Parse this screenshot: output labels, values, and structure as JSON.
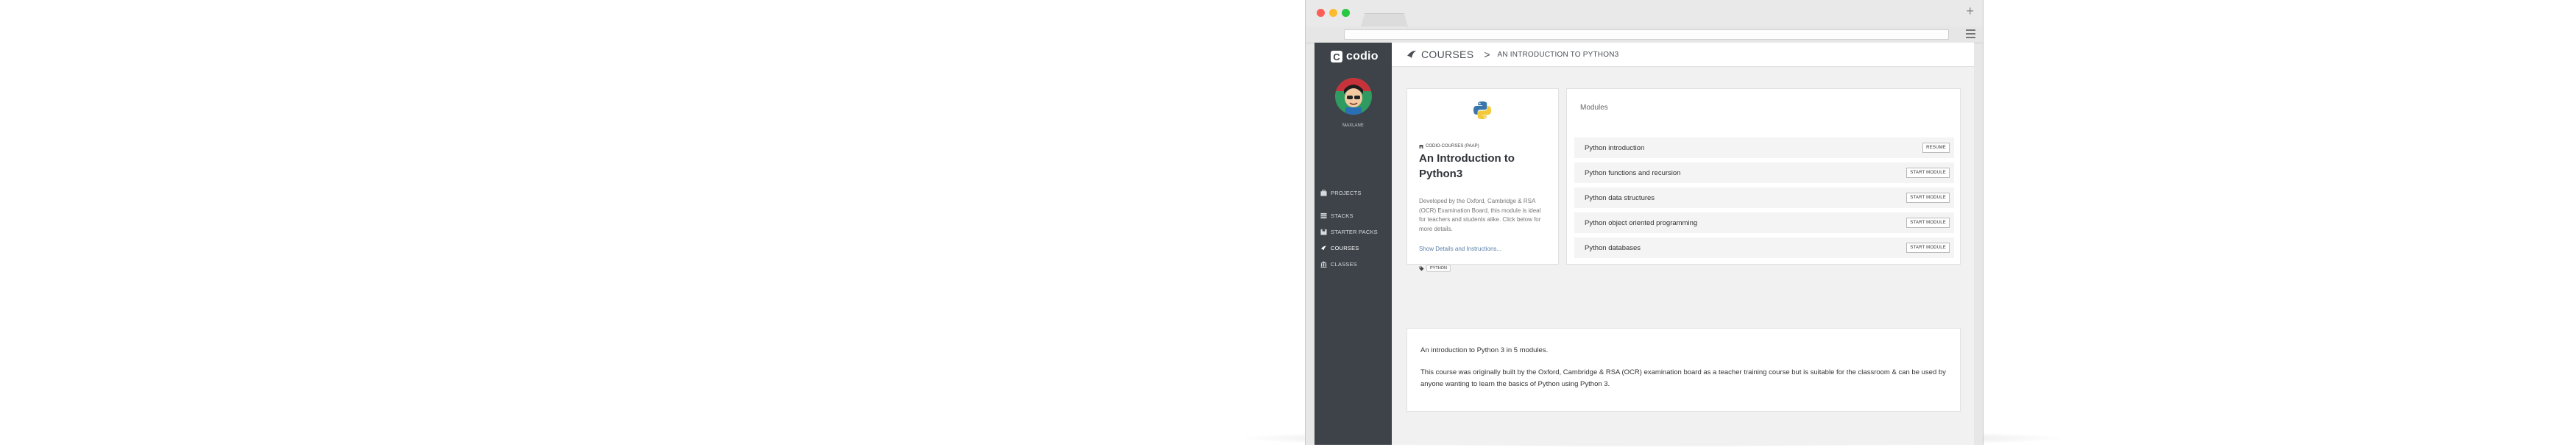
{
  "app": {
    "logo_text": "codio",
    "username": "MAXLANE"
  },
  "sidebar": {
    "items": [
      {
        "label": "PROJECTS",
        "icon": "briefcase-icon"
      },
      {
        "label": "STACKS",
        "icon": "stack-icon"
      },
      {
        "label": "STARTER PACKS",
        "icon": "box-icon"
      },
      {
        "label": "COURSES",
        "icon": "courses-icon",
        "active": true
      },
      {
        "label": "CLASSES",
        "icon": "classes-icon"
      }
    ]
  },
  "breadcrumb": {
    "root": "COURSES",
    "separator": ">",
    "current": "AN INTRODUCTION TO PYTHON3"
  },
  "course": {
    "owner": "CODIO-COURSES (PAAP)",
    "title": "An Introduction to Python3",
    "description": "Developed by the Oxford, Cambridge & RSA (OCR) Examination Board, this module is ideal for teachers and students alike. Click below for more details.",
    "show_link": "Show Details and Instructions...",
    "tag": "PYTHON"
  },
  "modules": {
    "title": "Modules",
    "items": [
      {
        "name": "Python introduction",
        "action": "RESUME"
      },
      {
        "name": "Python functions and recursion",
        "action": "START MODULE"
      },
      {
        "name": "Python data structures",
        "action": "START MODULE"
      },
      {
        "name": "Python object oriented programming",
        "action": "START MODULE"
      },
      {
        "name": "Python databases",
        "action": "START MODULE"
      }
    ]
  },
  "summary": {
    "intro": "An introduction to Python 3 in 5 modules.",
    "body": "This course was originally built by the Oxford, Cambridge & RSA (OCR) examination board as a teacher training course but is suitable for the classroom & can be used by anyone wanting to learn the basics of Python using Python 3."
  },
  "colors": {
    "sidebar_bg": "#3e434a",
    "content_bg": "#f1f1f1",
    "link": "#5a7fa8"
  }
}
